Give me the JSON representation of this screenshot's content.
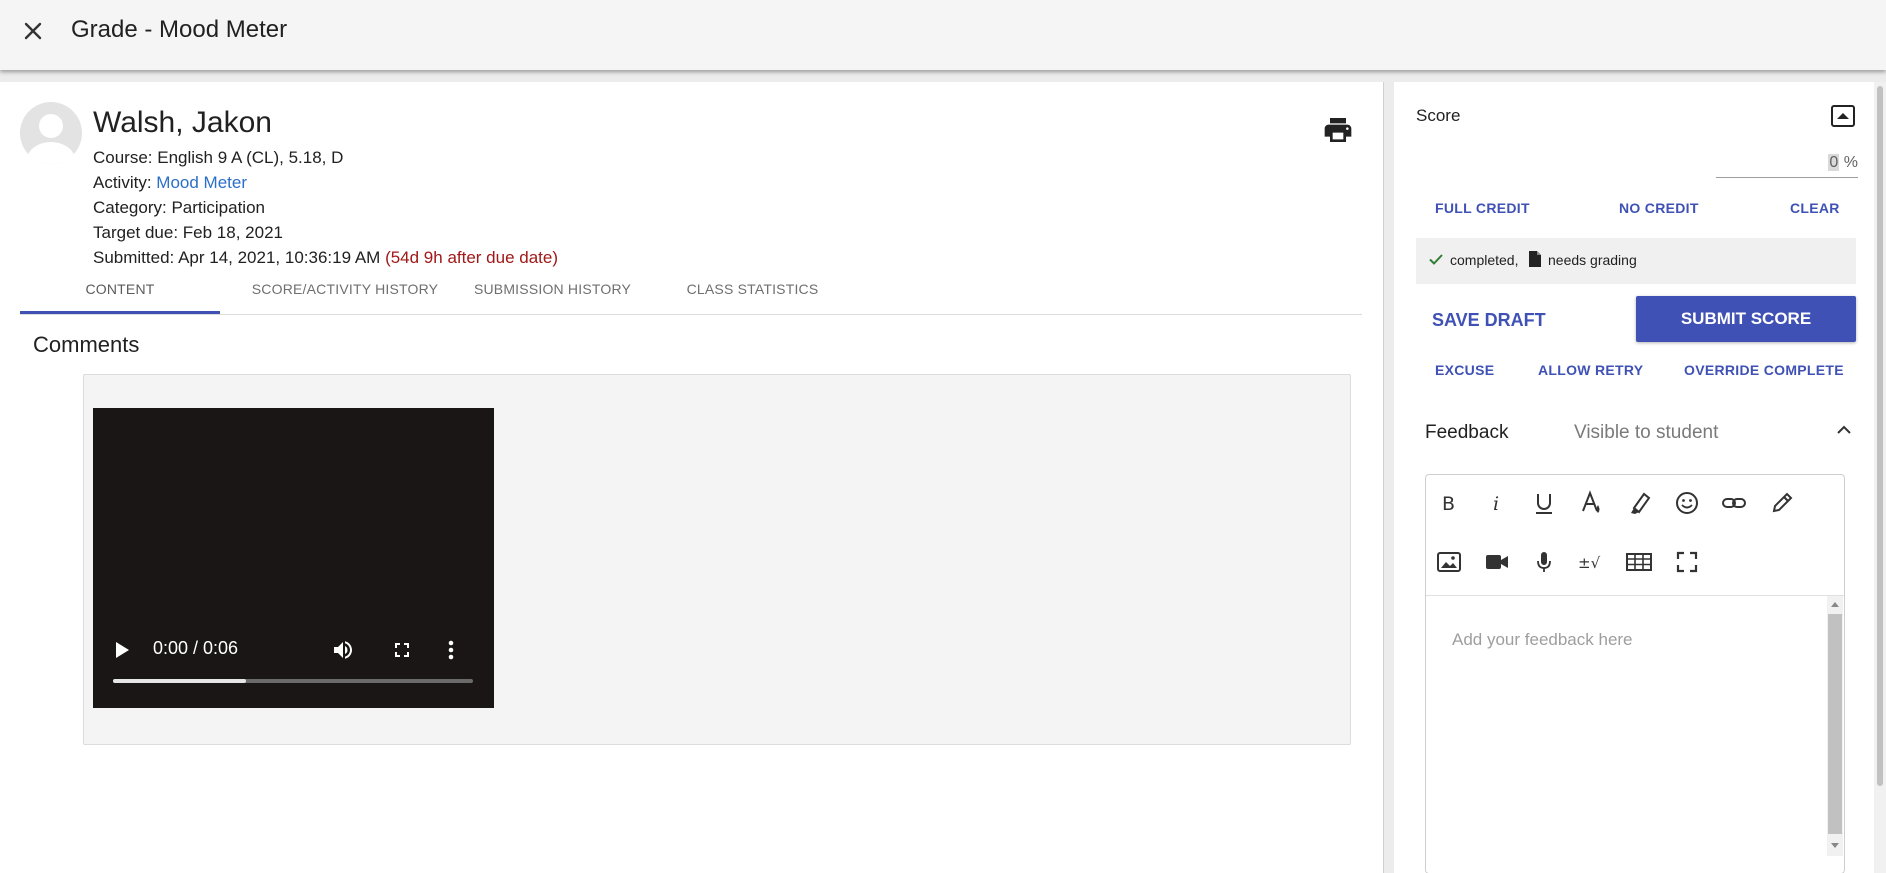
{
  "header": {
    "title": "Grade - Mood Meter"
  },
  "student": {
    "name": "Walsh, Jakon",
    "course_label": "Course: ",
    "course": "English 9 A (CL), 5.18, D",
    "activity_label": "Activity: ",
    "activity": "Mood Meter",
    "category_label": "Category: ",
    "category": "Participation",
    "target_label": "Target due: ",
    "target_due": "Feb 18, 2021",
    "submitted_label": "Submitted: ",
    "submitted": "Apr 14, 2021, 10:36:19 AM",
    "late": "(54d 9h after due date)"
  },
  "tabs": [
    {
      "label": "CONTENT"
    },
    {
      "label": "SCORE/ACTIVITY HISTORY"
    },
    {
      "label": "SUBMISSION HISTORY"
    },
    {
      "label": "CLASS STATISTICS"
    }
  ],
  "content": {
    "section_title": "Comments",
    "video": {
      "time": "0:00 / 0:06",
      "progress_fraction": 0.37
    }
  },
  "score": {
    "label": "Score",
    "value": "0",
    "unit": " %",
    "full_credit": "FULL CREDIT",
    "no_credit": "NO CREDIT",
    "clear": "CLEAR",
    "status_completed": "completed,",
    "status_needs": "needs grading",
    "save_draft": "SAVE DRAFT",
    "submit": "SUBMIT SCORE",
    "excuse": "EXCUSE",
    "allow_retry": "ALLOW RETRY",
    "override": "OVERRIDE COMPLETE"
  },
  "feedback": {
    "label": "Feedback",
    "visibility": "Visible to student",
    "placeholder": "Add your feedback here"
  },
  "colors": {
    "accent": "#3f51b5",
    "link": "#2b6fc8",
    "late": "#a01818",
    "status_check": "#2e7d32"
  }
}
